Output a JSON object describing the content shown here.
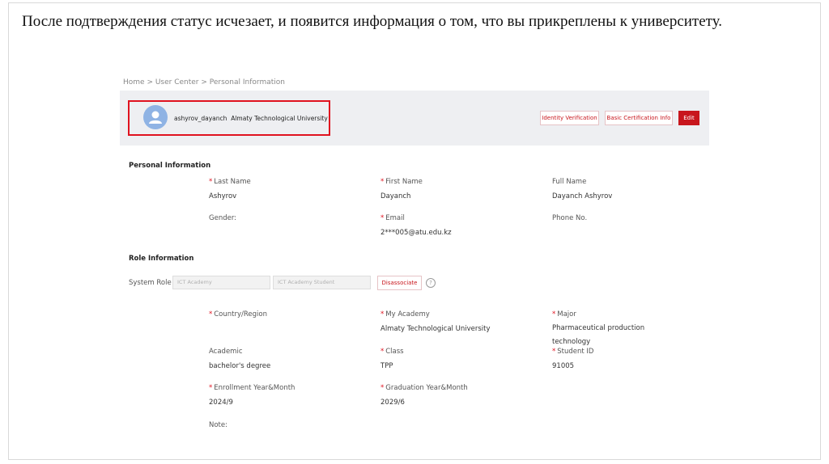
{
  "slide": {
    "caption": "После подтверждения статус исчезает, и появится информация о том, что вы прикреплены к университету."
  },
  "breadcrumb": "Home > User Center > Personal Information",
  "profile": {
    "username": "ashyrov_dayanch",
    "university": "Almaty Technological University",
    "buttons": {
      "identity_verification": "Identity Verification",
      "basic_certification": "Basic Certification Info",
      "edit": "Edit"
    },
    "highlight_color": "#e0121f"
  },
  "personal_info": {
    "heading": "Personal Information",
    "fields": [
      {
        "label": "Last Name",
        "required": true,
        "value": "Ashyrov"
      },
      {
        "label": "First Name",
        "required": true,
        "value": "Dayanch"
      },
      {
        "label": "Full Name",
        "required": false,
        "value": "Dayanch Ashyrov"
      },
      {
        "label": "Gender:",
        "required": false,
        "value": ""
      },
      {
        "label": "Email",
        "required": true,
        "value": "2***005@atu.edu.kz"
      },
      {
        "label": "Phone No.",
        "required": false,
        "value": ""
      }
    ]
  },
  "role_info": {
    "heading": "Role Information",
    "system_role_label": "System Role",
    "role_input_1": "ICT Academy",
    "role_input_2": "ICT Academy Student",
    "disassociate_label": "Disassociate",
    "help_icon": "?",
    "fields": [
      {
        "label": "Country/Region",
        "required": true,
        "value": ""
      },
      {
        "label": "My Academy",
        "required": true,
        "value": "Almaty Technological University"
      },
      {
        "label": "Major",
        "required": true,
        "value": "Pharmaceutical production technology"
      },
      {
        "label": "Academic",
        "required": false,
        "value": "bachelor's degree"
      },
      {
        "label": "Class",
        "required": true,
        "value": "TPP"
      },
      {
        "label": "Student ID",
        "required": true,
        "value": "91005"
      },
      {
        "label": "Enrollment Year&Month",
        "required": true,
        "value": "2024/9"
      },
      {
        "label": "Graduation Year&Month",
        "required": true,
        "value": "2029/6"
      },
      {
        "label": "Note:",
        "required": false,
        "value": ""
      }
    ]
  },
  "colors": {
    "accent_red": "#c8161d",
    "banner_bg": "#eeeff2",
    "avatar_blue": "#8fb3e4"
  }
}
